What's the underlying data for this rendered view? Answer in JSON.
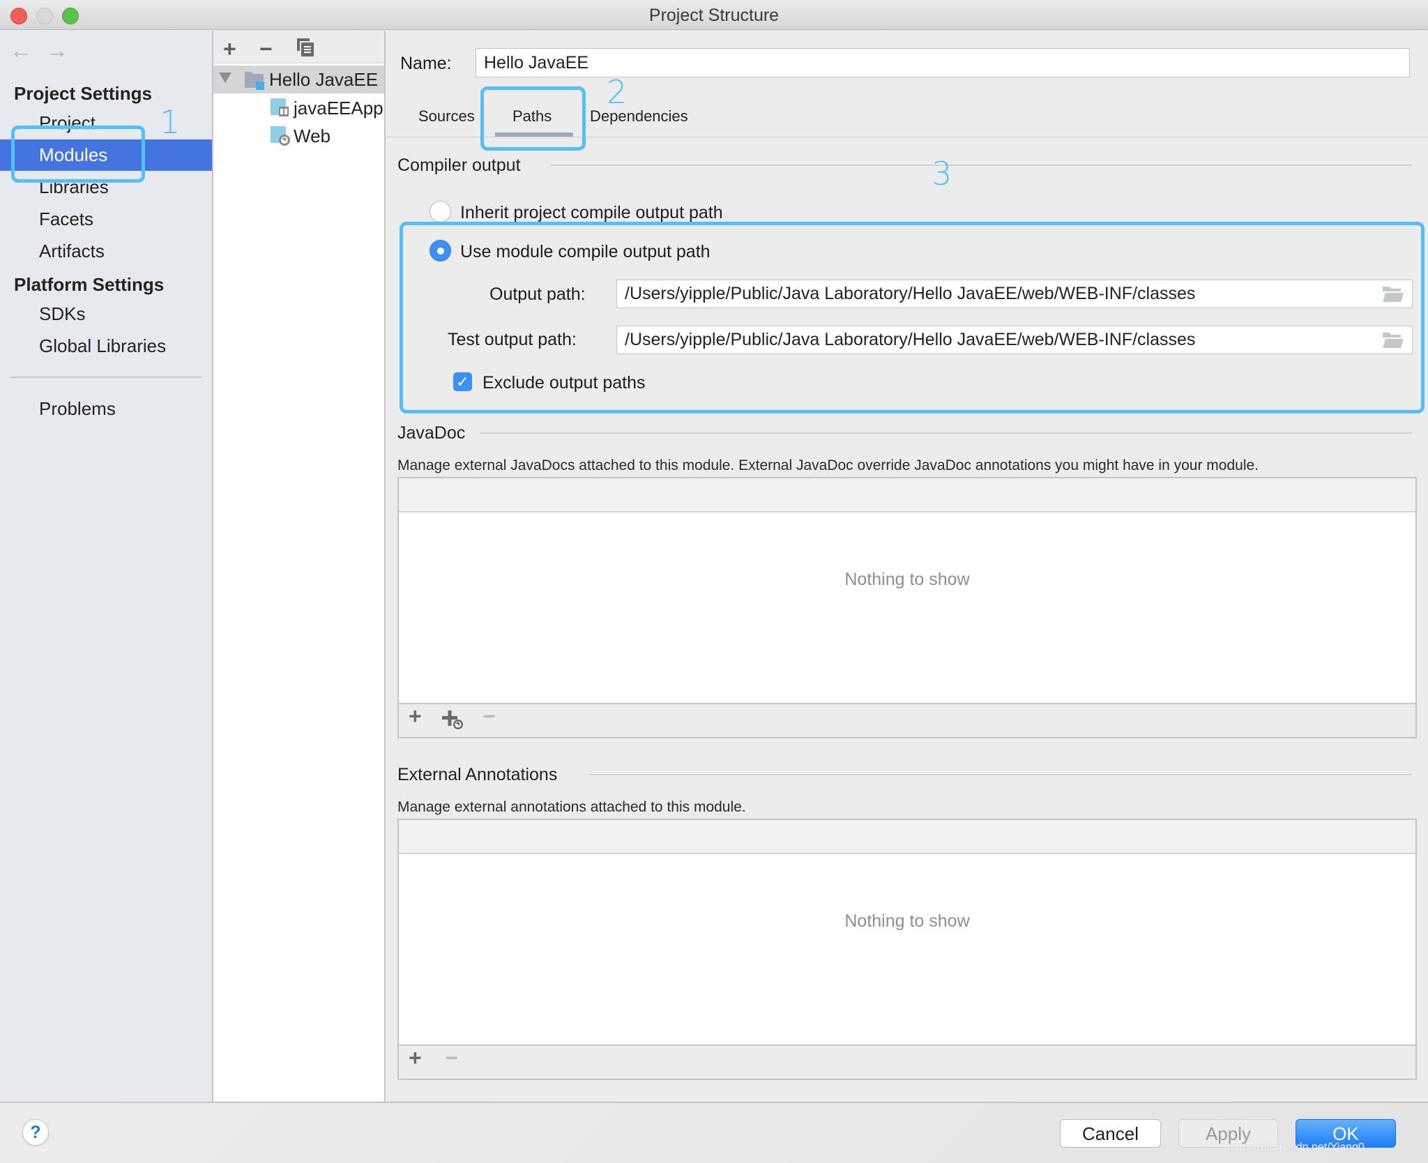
{
  "window": {
    "title": "Project Structure"
  },
  "sidebar": {
    "nav_back": "←",
    "nav_forward": "→",
    "project_settings_header": "Project Settings",
    "project_items": [
      "Project",
      "Modules",
      "Libraries",
      "Facets",
      "Artifacts"
    ],
    "selected_item": "Modules",
    "platform_settings_header": "Platform Settings",
    "platform_items": [
      "SDKs",
      "Global Libraries"
    ],
    "problems": "Problems"
  },
  "tree": {
    "toolbar": {
      "add": "+",
      "remove": "−",
      "copy_icon": "copy-icon"
    },
    "root": {
      "label": "Hello JavaEE",
      "icon": "module-folder-icon",
      "expanded": true
    },
    "children": [
      {
        "label": "javaEEApp",
        "icon": "javaee-facet-icon"
      },
      {
        "label": "Web",
        "icon": "web-facet-icon"
      }
    ]
  },
  "main": {
    "name_label": "Name:",
    "name_value": "Hello JavaEE",
    "tabs": [
      {
        "label": "Sources",
        "active": false
      },
      {
        "label": "Paths",
        "active": true
      },
      {
        "label": "Dependencies",
        "active": false
      }
    ],
    "compiler_output": {
      "title": "Compiler output",
      "inherit_option": "Inherit project compile output path",
      "inherit_selected": false,
      "module_option": "Use module compile output path",
      "module_selected": true,
      "output_path_label": "Output path:",
      "output_path_value": "/Users/yipple/Public/Java Laboratory/Hello JavaEE/web/WEB-INF/classes",
      "test_output_path_label": "Test output path:",
      "test_output_path_value": "/Users/yipple/Public/Java Laboratory/Hello JavaEE/web/WEB-INF/classes",
      "exclude_label": "Exclude output paths",
      "exclude_checked": true,
      "checkmark": "✓"
    },
    "javadoc": {
      "title": "JavaDoc",
      "description": "Manage external JavaDocs attached to this module. External JavaDoc override JavaDoc annotations you might have in your module.",
      "empty_text": "Nothing to show",
      "add": "+",
      "remove": "−"
    },
    "external_annotations": {
      "title": "External Annotations",
      "description": "Manage external annotations attached to this module.",
      "empty_text": "Nothing to show",
      "add": "+",
      "remove": "−"
    }
  },
  "annotations": {
    "one": "1",
    "two": "2",
    "three": "3",
    "color": "#54c0f7"
  },
  "footer": {
    "help": "?",
    "cancel": "Cancel",
    "apply": "Apply",
    "ok": "OK",
    "watermark": "https://blog.csdn.net/Yiang0"
  },
  "colors": {
    "selection": "#4374e0",
    "accent": "#3d8ff4",
    "ok_button": "#1e7ef7"
  }
}
